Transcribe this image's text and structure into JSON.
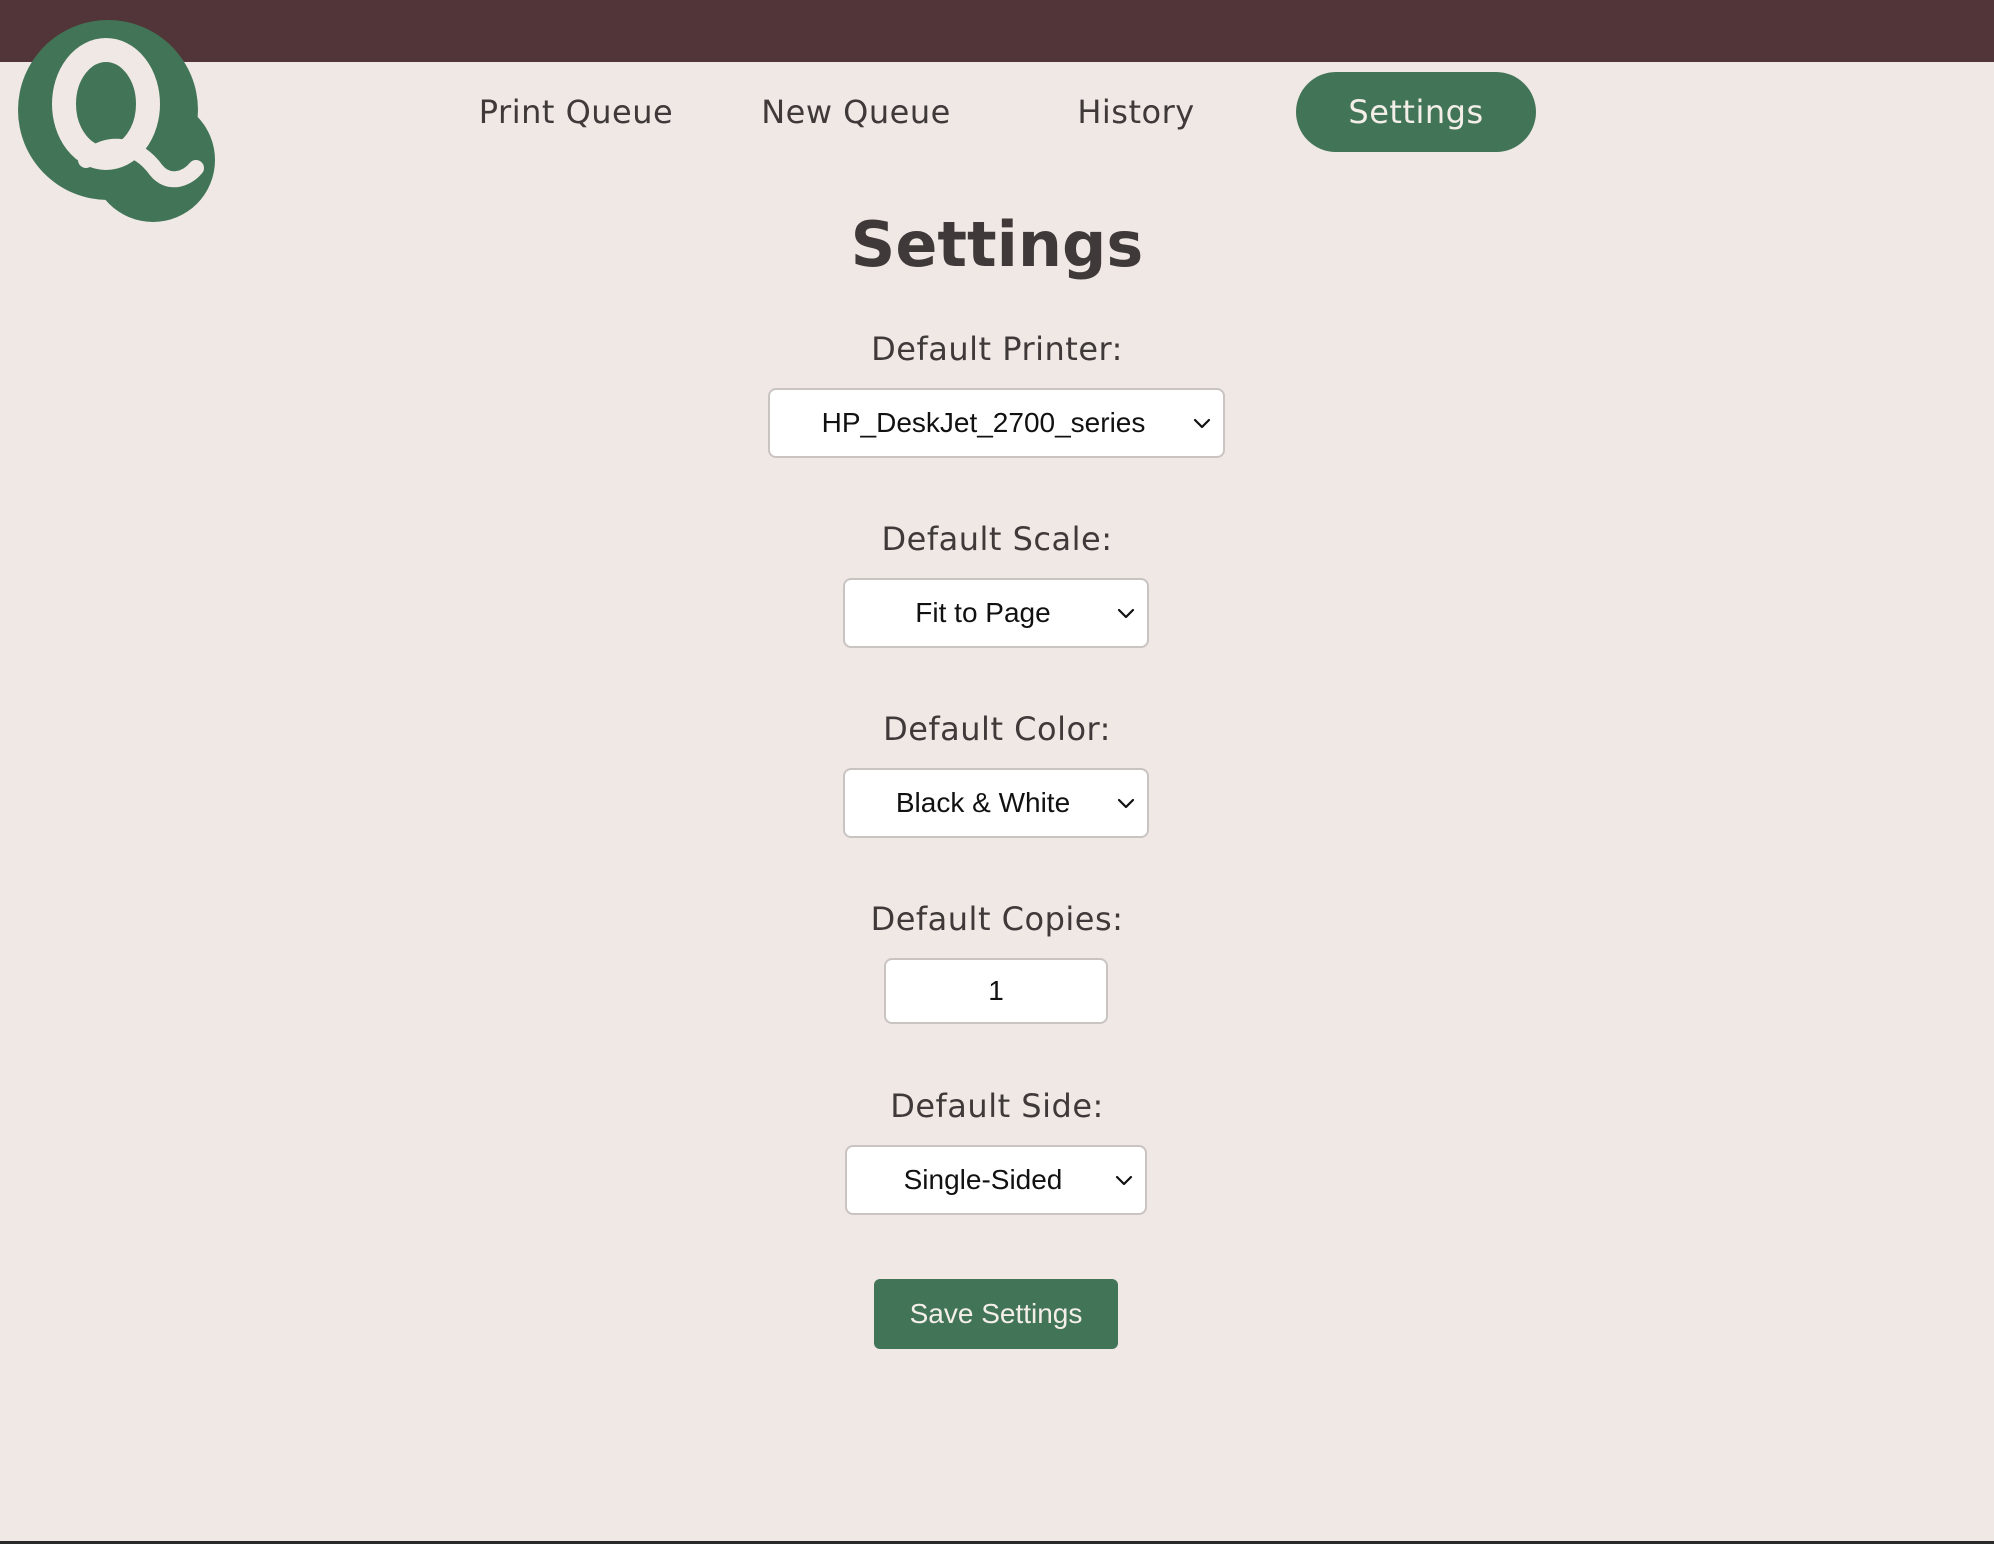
{
  "app": {
    "logo_letter": "Q",
    "accent_color": "#427557",
    "header_color": "#523538",
    "background_color": "#efe8e5"
  },
  "nav": {
    "items": [
      {
        "label": "Print Queue",
        "active": false
      },
      {
        "label": "New Queue",
        "active": false
      },
      {
        "label": "History",
        "active": false
      },
      {
        "label": "Settings",
        "active": true
      }
    ]
  },
  "page": {
    "title": "Settings"
  },
  "settings": {
    "printer": {
      "label": "Default Printer:",
      "value": "HP_DeskJet_2700_series"
    },
    "scale": {
      "label": "Default Scale:",
      "value": "Fit to Page"
    },
    "color": {
      "label": "Default Color:",
      "value": "Black & White"
    },
    "copies": {
      "label": "Default Copies:",
      "value": "1"
    },
    "side": {
      "label": "Default Side:",
      "value": "Single-Sided"
    }
  },
  "actions": {
    "save_label": "Save Settings"
  },
  "icons": {
    "logo": "q-logo-icon",
    "dropdown": "chevron-down-icon"
  }
}
